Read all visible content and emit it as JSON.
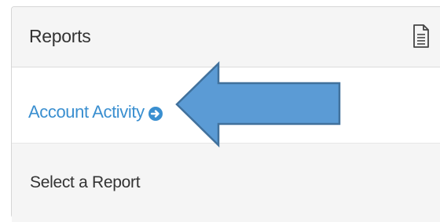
{
  "panel": {
    "title": "Reports",
    "header_icon": "document-icon"
  },
  "report_link": {
    "label": "Account Activity",
    "icon": "arrow-circle-right-icon",
    "color": "#3a8fd0"
  },
  "select": {
    "label": "Select a Report"
  },
  "annotation": {
    "icon": "left-pointing-arrow",
    "fill": "#5b9bd5",
    "stroke": "#41719c"
  }
}
